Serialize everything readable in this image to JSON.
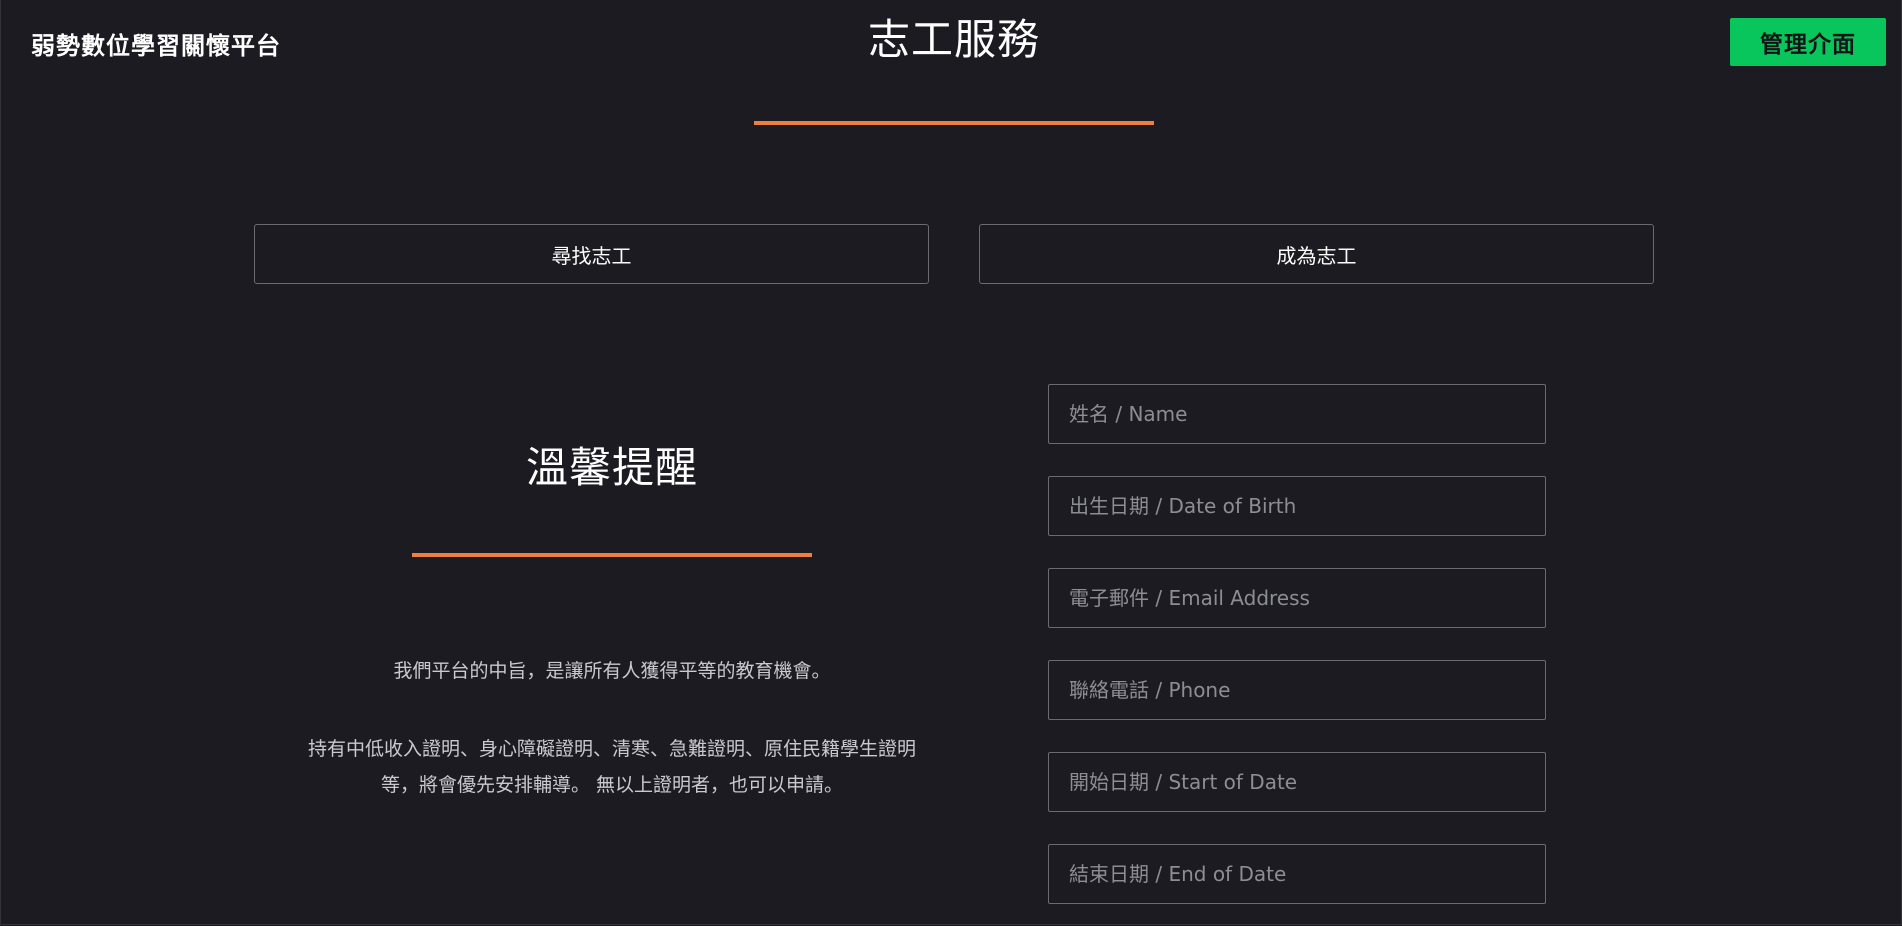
{
  "header": {
    "brand": "弱勢數位學習關懷平台",
    "admin_button": "管理介面"
  },
  "main": {
    "title": "志工服務",
    "tabs": [
      {
        "label": "尋找志工"
      },
      {
        "label": "成為志工"
      }
    ]
  },
  "notice": {
    "title": "溫馨提醒",
    "paragraph_1": "我們平台的中旨，是讓所有人獲得平等的教育機會。",
    "paragraph_2": "持有中低收入證明、身心障礙證明、清寒、急難證明、原住民籍學生證明等，將會優先安排輔導。 無以上證明者，也可以申請。"
  },
  "form": {
    "name": {
      "placeholder": "姓名 / Name",
      "value": ""
    },
    "dob": {
      "placeholder": "出生日期 / Date of Birth",
      "value": ""
    },
    "email": {
      "placeholder": "電子郵件 / Email Address",
      "value": ""
    },
    "phone": {
      "placeholder": "聯絡電話 / Phone",
      "value": ""
    },
    "start_date": {
      "placeholder": "開始日期 / Start of Date",
      "value": ""
    },
    "end_date": {
      "placeholder": "結束日期 / End of Date",
      "value": ""
    }
  },
  "colors": {
    "background": "#1b1b21",
    "accent": "#ee7f3e",
    "admin_button": "#08c55c"
  }
}
